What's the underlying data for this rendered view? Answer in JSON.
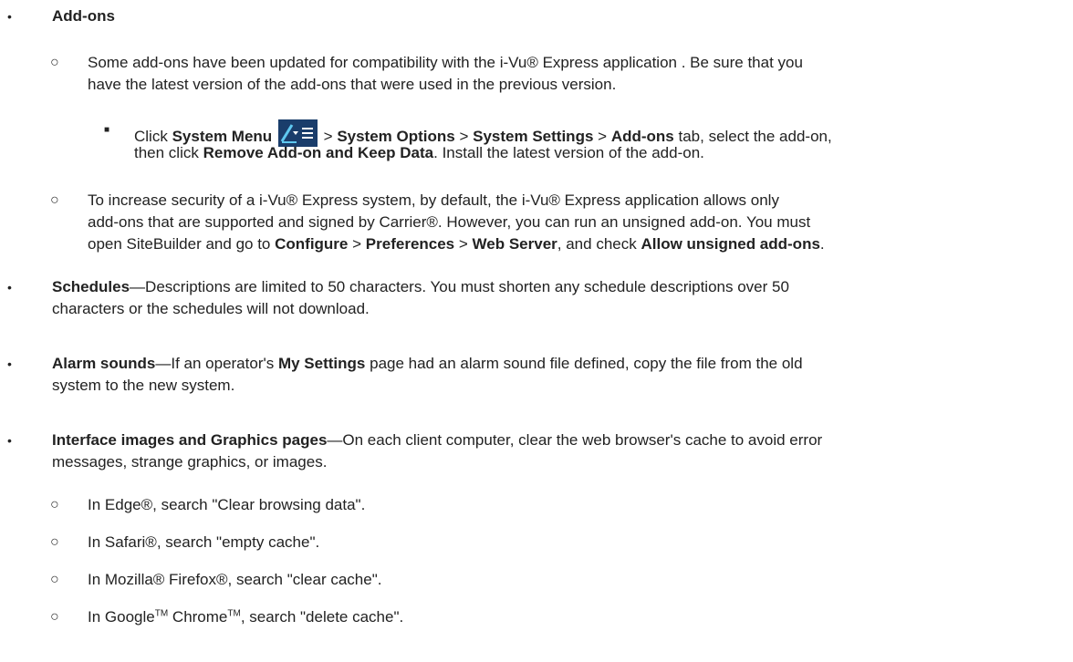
{
  "addons": {
    "heading": "Add-ons",
    "sub1_line1": "Some add-ons have been updated for compatibility with the i-Vu® Express application . Be sure that you",
    "sub1_line2": "have the latest version of the add-ons that were used in the previous version.",
    "step": {
      "click": "Click",
      "system_menu": "System Menu",
      "gt1": ">",
      "system_options": "System Options",
      "gt2": ">",
      "system_settings": "System Settings",
      "gt3": ">",
      "addons_tab": "Add-ons",
      "tab_text": "tab, select the add-on,",
      "then_click": "then click",
      "remove_keep": "Remove Add-on and Keep Data",
      "install_text": ". Install the latest version of the add-on."
    },
    "sub2_line1": "To increase security of a i-Vu® Express system, by default, the i-Vu® Express application allows only",
    "sub2_line2": "add-ons that are supported and signed by Carrier®. However, you can run an unsigned add-on. You must",
    "sub2_line3": {
      "pre": "open SiteBuilder and go to",
      "configure": "Configure",
      "gt1": ">",
      "preferences": "Preferences",
      "gt2": ">",
      "web_server": "Web Server",
      "and_check": ", and check",
      "allow_unsigned": "Allow unsigned add-ons",
      "end": "."
    }
  },
  "schedules": {
    "heading": "Schedules",
    "line1_rest": "—Descriptions are limited to 50 characters. You must shorten any schedule descriptions over 50",
    "line2": "characters or the schedules will not download."
  },
  "alarm": {
    "heading": "Alarm sounds",
    "line1_pre": "—If an operator's",
    "my_settings": "My Settings",
    "line1_post": "page had an alarm sound file defined, copy the file from the old",
    "line2": "system to the new system."
  },
  "interface": {
    "heading": "Interface images and Graphics pages",
    "line1_rest": "—On each client computer, clear the web browser's cache to avoid error",
    "line2": "messages, strange graphics, or images.",
    "browsers": [
      "In Edge®, search \"Clear browsing data\".",
      "In Safari®, search \"empty cache\".",
      "In Mozilla® Firefox®, search \"clear cache\"."
    ],
    "chrome": {
      "pre": "In Google",
      "tm1": "TM",
      "mid": " Chrome",
      "tm2": "TM",
      "post": ", search \"delete cache\"."
    }
  },
  "bullets": {
    "filled": "•",
    "hollow": "○",
    "square": "■"
  },
  "colors": {
    "text": "#222222",
    "icon_bg": "#1a3d6b",
    "icon_accent": "#5fc8f0"
  },
  "icons": {
    "system_menu": "system-menu-icon"
  }
}
